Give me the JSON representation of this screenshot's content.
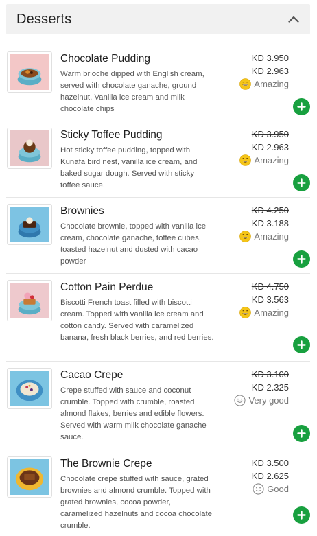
{
  "section": {
    "title": "Desserts",
    "collapse_icon": "chevron-up-icon"
  },
  "items": [
    {
      "name": "Chocolate Pudding",
      "description": "Warm brioche dipped with English cream, served with chocolate ganache, ground hazelnut, Vanilla ice cream and milk chocolate chips",
      "old_price": "KD 3.950",
      "price": "KD 2.963",
      "rating_label": "Amazing",
      "rating_icon": "grin-emoji-icon",
      "thumb_bg": "#f3c7c7",
      "dish_color": "#7fc6d9"
    },
    {
      "name": "Sticky Toffee Pudding",
      "description": "Hot sticky toffee pudding, topped with Kunafa bird nest, vanilla ice cream, and baked sugar dough. Served with sticky toffee sauce.",
      "old_price": "KD 3.950",
      "price": "KD 2.963",
      "rating_label": "Amazing",
      "rating_icon": "grin-emoji-icon",
      "thumb_bg": "#e9c7c9",
      "dish_color": "#7fc6d9"
    },
    {
      "name": "Brownies",
      "description": "Chocolate brownie, topped with vanilla ice cream, chocolate ganache, toffee cubes, toasted hazelnut and dusted with cacao powder",
      "old_price": "KD 4.250",
      "price": "KD 3.188",
      "rating_label": "Amazing",
      "rating_icon": "grin-emoji-icon",
      "thumb_bg": "#7dc3e3",
      "dish_color": "#3f8fc4"
    },
    {
      "name": "Cotton Pain Perdue",
      "description": "Biscotti French toast filled with biscotti cream. Topped with vanilla ice cream and cotton candy. Served with caramelized banana, fresh black berries, and red berries.",
      "old_price": "KD 4.750",
      "price": "KD 3.563",
      "rating_label": "Amazing",
      "rating_icon": "grin-emoji-icon",
      "thumb_bg": "#eec9cd",
      "dish_color": "#7fc6d9"
    },
    {
      "name": "Cacao Crepe",
      "description": "Crepe stuffed with sauce and coconut crumble. Topped with crumble, roasted almond flakes, berries and edible flowers. Served with warm milk chocolate ganache sauce.",
      "old_price": "KD 3.100",
      "price": "KD 2.325",
      "rating_label": "Very good",
      "rating_icon": "smile-outline-icon",
      "thumb_bg": "#7cc4e2",
      "dish_color": "#3f8fc4"
    },
    {
      "name": "The Brownie Crepe",
      "description": "Chocolate crepe stuffed with sauce, grated brownies and almond crumble. Topped with grated brownies, cocoa powder, caramelized hazelnuts and cocoa chocolate crumble.",
      "old_price": "KD 3.500",
      "price": "KD 2.625",
      "rating_label": "Good",
      "rating_icon": "slight-smile-outline-icon",
      "thumb_bg": "#7cc4e2",
      "dish_color": "#f0b730"
    }
  ],
  "add_button_icon": "plus-icon",
  "colors": {
    "accent_green": "#18a03f",
    "header_bg": "#f1f1f1",
    "emoji_yellow": "#f5c518"
  }
}
